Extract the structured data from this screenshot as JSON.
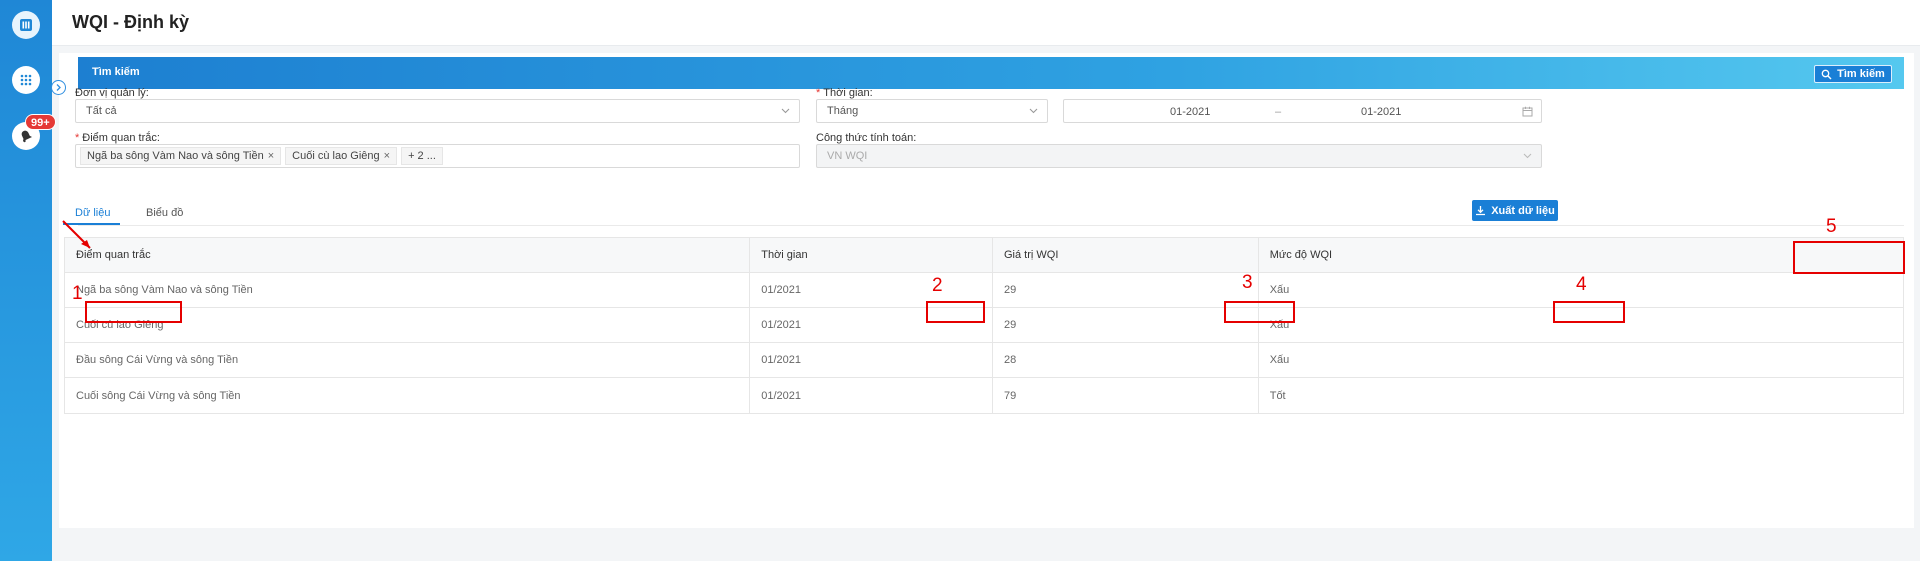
{
  "app": {
    "notification_badge": "99+",
    "page_title": "WQI - Định kỳ"
  },
  "search": {
    "title": "Tìm kiếm",
    "button_label": "Tìm kiếm",
    "management_unit": {
      "label": "Đơn vị quản lý:",
      "value": "Tất cả"
    },
    "time": {
      "label": "Thời gian:",
      "type_value": "Tháng",
      "from": "01-2021",
      "separator": "–",
      "to": "01-2021"
    },
    "monitoring_points": {
      "label": "Điểm quan trắc:",
      "tags": [
        "Ngã ba sông Vàm Nao và sông Tiền",
        "Cuối cù lao Giêng"
      ],
      "more": "+ 2 ..."
    },
    "formula": {
      "label": "Công thức tính toán:",
      "value": "VN WQI"
    }
  },
  "tabs": [
    "Dữ liệu",
    "Biểu đồ"
  ],
  "export_label": "Xuất dữ liệu",
  "table": {
    "headers": [
      "Điểm quan trắc",
      "Thời gian",
      "Giá trị WQI",
      "Mức độ WQI"
    ],
    "rows": [
      [
        "Ngã ba sông Vàm Nao và sông Tiền",
        "01/2021",
        "29",
        "Xấu"
      ],
      [
        "Cuối cù lao Giêng",
        "01/2021",
        "29",
        "Xấu"
      ],
      [
        "Đầu sông Cái Vừng và sông Tiền",
        "01/2021",
        "28",
        "Xấu"
      ],
      [
        "Cuối sông Cái Vừng và sông Tiền",
        "01/2021",
        "79",
        "Tốt"
      ]
    ]
  },
  "annotations": [
    "1",
    "2",
    "3",
    "4",
    "5"
  ],
  "colors": {
    "primary": "#1a7fd6",
    "annotation": "#e50000",
    "badge": "#e53935"
  }
}
